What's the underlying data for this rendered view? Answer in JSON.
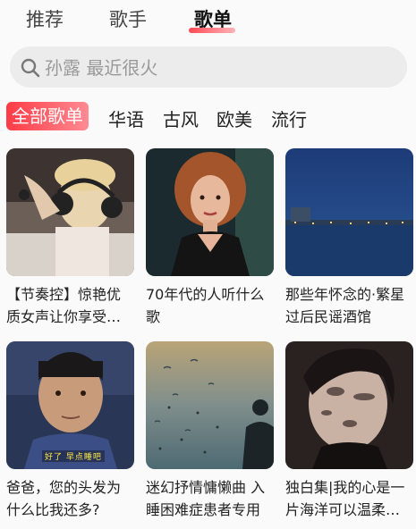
{
  "tabs": [
    {
      "label": "推荐"
    },
    {
      "label": "歌手"
    },
    {
      "label": "歌单",
      "active": true
    }
  ],
  "search": {
    "placeholder": "孙露 最近很火",
    "icon": "search-icon"
  },
  "categories": [
    {
      "label": "全部歌单",
      "active": true
    },
    {
      "label": "华语"
    },
    {
      "label": "古风"
    },
    {
      "label": "欧美"
    },
    {
      "label": "流行"
    }
  ],
  "playlists": [
    {
      "title": "【节奏控】惊艳优质女声让你享受一场听觉盛宴"
    },
    {
      "title": "70年代的人听什么歌"
    },
    {
      "title": "那些年怀念的·繁星过后民谣酒馆"
    },
    {
      "title": "爸爸，您的头发为什么比我还多?",
      "cover_caption": "好了 早点睡吧"
    },
    {
      "title": "迷幻抒情慵懒曲 入睡困难症患者专用"
    },
    {
      "title": "独白集|我的心是一片海洋可以温柔却澎湃"
    }
  ],
  "colors": {
    "accent": "#ff3b46",
    "background": "#fafafa"
  }
}
